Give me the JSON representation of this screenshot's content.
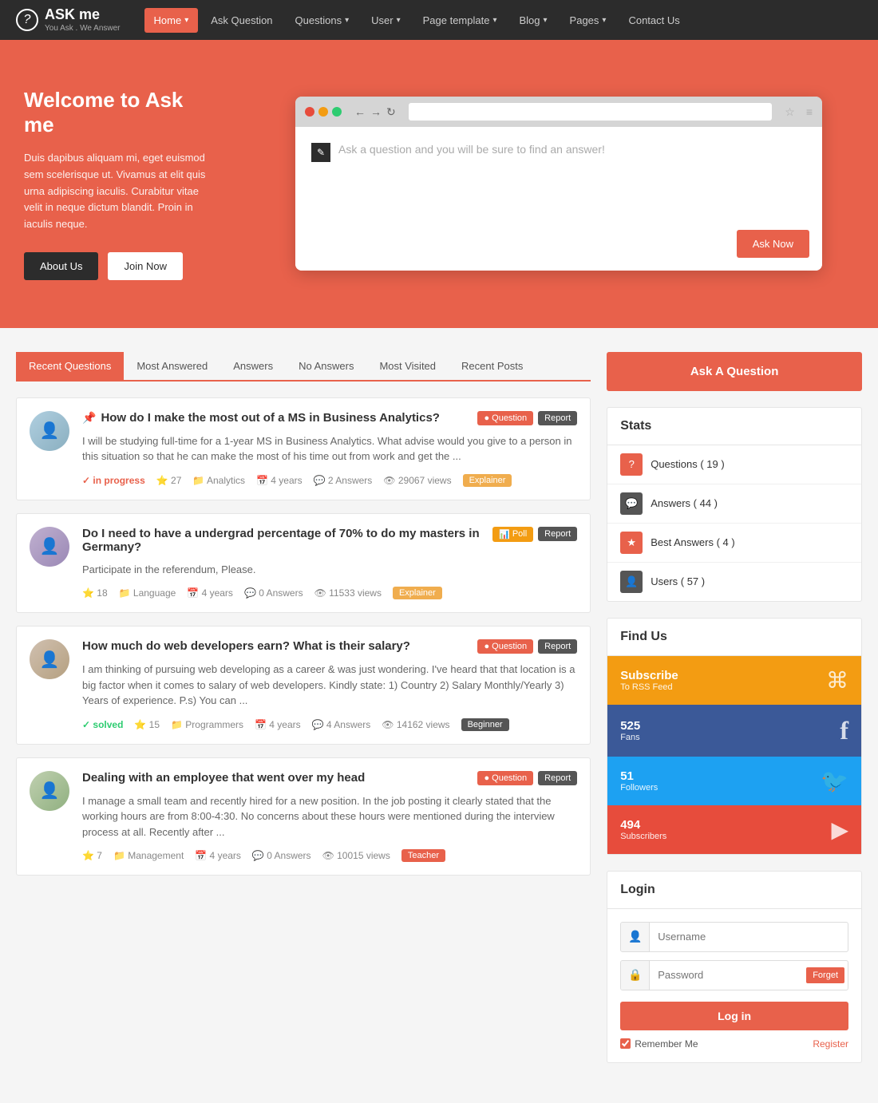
{
  "nav": {
    "logo": {
      "icon": "?",
      "name": "ASK me",
      "tagline": "You Ask . We Answer"
    },
    "items": [
      {
        "label": "Home",
        "active": true,
        "hasDropdown": true
      },
      {
        "label": "Ask Question",
        "active": false,
        "hasDropdown": false
      },
      {
        "label": "Questions",
        "active": false,
        "hasDropdown": true
      },
      {
        "label": "User",
        "active": false,
        "hasDropdown": true
      },
      {
        "label": "Page template",
        "active": false,
        "hasDropdown": true
      },
      {
        "label": "Blog",
        "active": false,
        "hasDropdown": true
      },
      {
        "label": "Pages",
        "active": false,
        "hasDropdown": true
      },
      {
        "label": "Contact Us",
        "active": false,
        "hasDropdown": false
      }
    ]
  },
  "hero": {
    "title": "Welcome to Ask me",
    "description": "Duis dapibus aliquam mi, eget euismod sem scelerisque ut. Vivamus at elit quis urna adipiscing iaculis. Curabitur vitae velit in neque dictum blandit. Proin in iaculis neque.",
    "btn_about": "About Us",
    "btn_join": "Join Now",
    "browser_placeholder": "Ask a question and you will be sure to find an answer!",
    "ask_now_label": "Ask Now"
  },
  "tabs": [
    {
      "label": "Recent Questions",
      "active": true
    },
    {
      "label": "Most Answered",
      "active": false
    },
    {
      "label": "Answers",
      "active": false
    },
    {
      "label": "No Answers",
      "active": false
    },
    {
      "label": "Most Visited",
      "active": false
    },
    {
      "label": "Recent Posts",
      "active": false
    }
  ],
  "questions": [
    {
      "id": 1,
      "pinned": true,
      "title": "How do I make the most out of a MS in Business Analytics?",
      "badge": "Question",
      "badge_type": "question",
      "excerpt": "I will be studying full-time for a 1-year MS in Business Analytics. What advise would you give to a person in this situation so that he can make the most of his time out from work and get the ...",
      "status": "in progress",
      "stars": "27",
      "category": "Analytics",
      "time": "4 years",
      "answers": "2 Answers",
      "views": "29067 views",
      "tag": "Explainer",
      "tag_type": "explainer"
    },
    {
      "id": 2,
      "pinned": false,
      "title": "Do I need to have a undergrad percentage of 70% to do my masters in Germany?",
      "badge": "Poll",
      "badge_type": "poll",
      "excerpt": "Participate in the referendum, Please.",
      "status": "",
      "stars": "18",
      "category": "Language",
      "time": "4 years",
      "answers": "0 Answers",
      "views": "11533 views",
      "tag": "Explainer",
      "tag_type": "explainer"
    },
    {
      "id": 3,
      "pinned": false,
      "title": "How much do web developers earn? What is their salary?",
      "badge": "Question",
      "badge_type": "question",
      "excerpt": "I am thinking of pursuing web developing as a career & was just wondering. I've heard that that location is a big factor when it comes to salary of web developers. Kindly state: 1) Country 2) Salary Monthly/Yearly 3) Years of experience. P.s) You can ...",
      "status": "solved",
      "stars": "15",
      "category": "Programmers",
      "time": "4 years",
      "answers": "4 Answers",
      "views": "14162 views",
      "tag": "Beginner",
      "tag_type": "beginner"
    },
    {
      "id": 4,
      "pinned": false,
      "title": "Dealing with an employee that went over my head",
      "badge": "Question",
      "badge_type": "question",
      "excerpt": "I manage a small team and recently hired for a new position. In the job posting it clearly stated that the working hours are from 8:00-4:30. No concerns about these hours were mentioned during the interview process at all. Recently after ...",
      "status": "",
      "stars": "7",
      "category": "Management",
      "time": "4 years",
      "answers": "0 Answers",
      "views": "10015 views",
      "tag": "Teacher",
      "tag_type": "teacher"
    }
  ],
  "sidebar": {
    "ask_button_label": "Ask A Question",
    "stats_title": "Stats",
    "stats": [
      {
        "label": "Questions ( 19 )",
        "icon_type": "question"
      },
      {
        "label": "Answers ( 44 )",
        "icon_type": "answer"
      },
      {
        "label": "Best Answers ( 4 )",
        "icon_type": "best"
      },
      {
        "label": "Users ( 57 )",
        "icon_type": "users"
      }
    ],
    "find_us_title": "Find Us",
    "find_us": [
      {
        "count": "Subscribe",
        "sublabel": "To RSS Feed",
        "icon": "⌘",
        "type": "rss"
      },
      {
        "count": "525",
        "sublabel": "Fans",
        "icon": "f",
        "type": "facebook"
      },
      {
        "count": "51",
        "sublabel": "Followers",
        "icon": "🐦",
        "type": "twitter"
      },
      {
        "count": "494",
        "sublabel": "Subscribers",
        "icon": "▶",
        "type": "youtube"
      }
    ],
    "login_title": "Login",
    "username_placeholder": "Username",
    "password_placeholder": "Password",
    "forget_label": "Forget",
    "login_btn_label": "Log in",
    "remember_label": "Remember Me",
    "register_label": "Register"
  }
}
